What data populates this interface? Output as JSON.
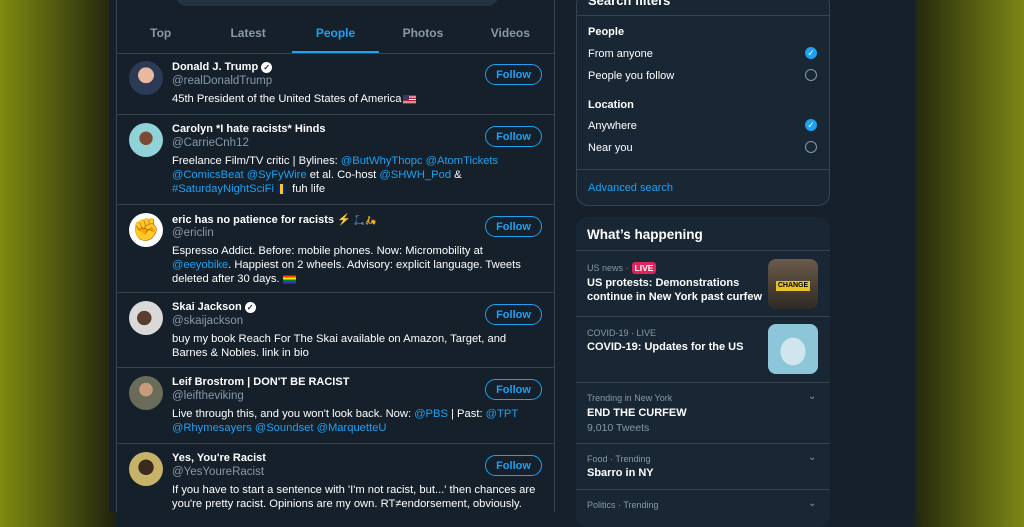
{
  "tabs": [
    "Top",
    "Latest",
    "People",
    "Photos",
    "Videos"
  ],
  "follow_label": "Follow",
  "users": [
    {
      "name": "Donald J. Trump",
      "handle": "@realDonaldTrump",
      "bio": "45th President of the United States of America"
    },
    {
      "name": "Carolyn *I hate racists* Hinds",
      "handle": "@CarrieCnh12",
      "bio_parts": [
        "Freelance Film/TV critic | Bylines: ",
        "@ButWhyThopc",
        " ",
        "@AtomTickets",
        " ",
        "@ComicsBeat",
        " ",
        "@SyFyWire",
        " et al. Co-host ",
        "@SHWH_Pod",
        " & ",
        "#SaturdayNightSciFi",
        " fuh life"
      ]
    },
    {
      "name": "eric has no patience for racists",
      "handle": "@ericlin",
      "bio_parts": [
        "Espresso Addict. Before: mobile phones. Now: Micromobility at ",
        "@eeyobike",
        ". Happiest on 2 wheels. Advisory: explicit language. Tweets deleted after 30 days. "
      ]
    },
    {
      "name": "Skai Jackson",
      "handle": "@skaijackson",
      "bio": "buy my book Reach For The Skai available on Amazon, Target, and Barnes & Nobles. link in bio"
    },
    {
      "name": "Leif Brostrom | DON'T BE RACIST",
      "handle": "@leiftheviking",
      "bio_parts": [
        "Live through this, and you won't look back. Now: ",
        "@PBS",
        " | Past: ",
        "@TPT",
        " ",
        "@Rhymesayers",
        " ",
        "@Soundset",
        " ",
        "@MarquetteU"
      ]
    },
    {
      "name": "Yes, You're Racist",
      "handle": "@YesYoureRacist",
      "bio": "If you have to start a sentence with 'I'm not racist, but...' then chances are you're pretty racist. Opinions are my own. RT≠endorsement, obviously."
    }
  ],
  "filters": {
    "title": "Search filters",
    "people_heading": "People",
    "people_options": [
      "From anyone",
      "People you follow"
    ],
    "location_heading": "Location",
    "location_options": [
      "Anywhere",
      "Near you"
    ],
    "advanced": "Advanced search"
  },
  "happening": {
    "title": "What’s happening",
    "live_label": "LIVE",
    "trends": [
      {
        "meta": "US news ·",
        "title": "US protests: Demonstrations continue in New York past curfew",
        "thumb_text": "CHANGE"
      },
      {
        "meta": "COVID-19 · LIVE",
        "title": "COVID-19: Updates for the US"
      },
      {
        "meta": "Trending in New York",
        "title": "END THE CURFEW",
        "sub": "9,010 Tweets"
      },
      {
        "meta": "Food · Trending",
        "title": "Sbarro in NY"
      },
      {
        "meta": "Politics · Trending"
      }
    ]
  },
  "colors": {
    "accent": "#1da1f2",
    "background": "#15202b",
    "card": "#192734",
    "live": "#e0245e"
  }
}
